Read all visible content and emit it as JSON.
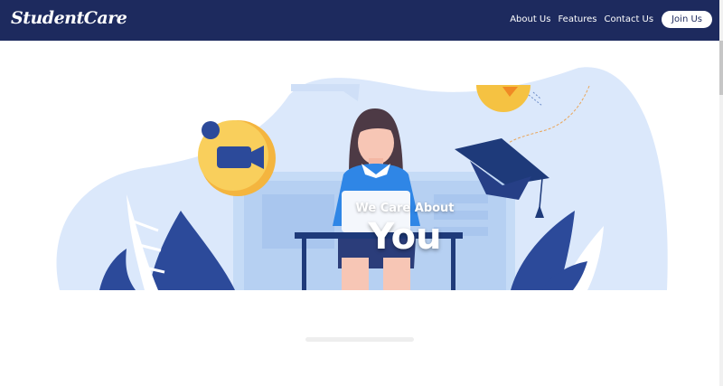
{
  "navbar": {
    "brand": "StudentCare",
    "links": [
      "About Us",
      "Features",
      "Contact Us"
    ],
    "join_label": "Join Us"
  },
  "hero": {
    "tagline": "We Care About",
    "headline": "You"
  },
  "colors": {
    "navbar_bg": "#1d2a5e",
    "illustration_light": "#dbe8fb",
    "illustration_dark": "#1e3a8a",
    "accent_yellow": "#f5c242"
  }
}
